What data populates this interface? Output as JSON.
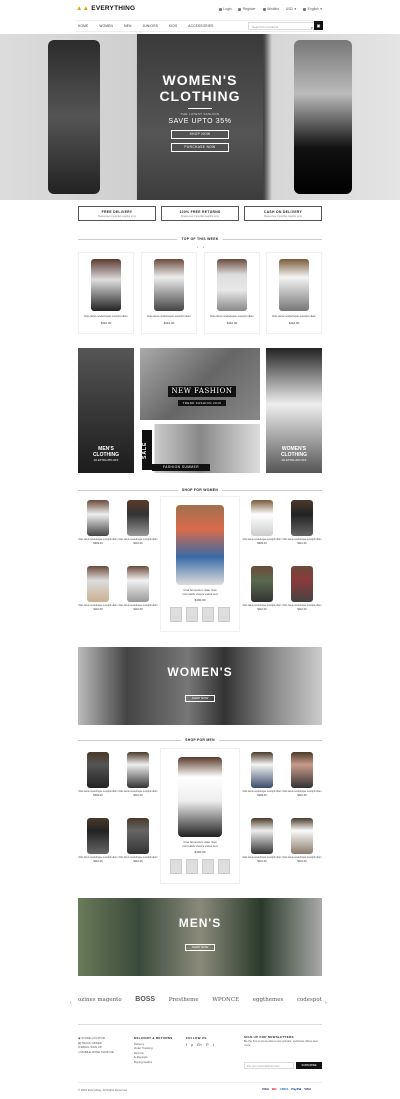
{
  "header": {
    "brand": "EVERYTHING",
    "links": [
      "Login",
      "Register",
      "Wishlist",
      "USD",
      "English"
    ],
    "nav": [
      "HOME",
      "WOMEN",
      "MEN",
      "JUNIORS",
      "KIDS",
      "ACCESSORIES"
    ],
    "search_placeholder": "Search for products"
  },
  "hero": {
    "title_line1": "WOMEN'S",
    "title_line2": "CLOTHING",
    "sub": "THE LATEST FASHION",
    "save": "SAVE UPTO 35%",
    "btn_shop": "SHOP NOW",
    "btn_purchase": "PURCHASE NOW"
  },
  "features": [
    {
      "title": "FREE DELIVERY",
      "text": "Maecenas imperdiet sagittis eros"
    },
    {
      "title": "100% FREE RETURNS",
      "text": "Maecenas imperdiet sagittis eros"
    },
    {
      "title": "CASH ON DELIVERY",
      "text": "Maecenas imperdiet sagittis eros"
    }
  ],
  "top_week": {
    "heading": "TOP OF THIS WEEK",
    "products": [
      {
        "name": "Duis lacus scelerisque suscipit ullam",
        "price": "$110.00"
      },
      {
        "name": "Duis lacus scelerisque suscipit ullam",
        "price": "$110.00"
      },
      {
        "name": "Duis lacus scelerisque suscipit ullam",
        "price": "$110.00"
      },
      {
        "name": "Duis lacus scelerisque suscipit ullam",
        "price": "$110.00"
      }
    ]
  },
  "banners": {
    "mens_line1": "MEN'S",
    "mens_line2": "CLOTHING",
    "mens_sub": "AN EXTRA 25% OFF",
    "new_fashion": "NEW FASHION",
    "trend": "TREND FASHION 2016",
    "sale": "SALE",
    "summer": "FASHION SUMMER",
    "womens_line1": "WOMEN'S",
    "womens_line2": "CLOTHING",
    "womens_sub": "AN EXTRA 20% OFF"
  },
  "shop_women": {
    "heading": "SHOP FOR WOMEN",
    "products": [
      {
        "name": "Duis lacus scelerisque suscipit ullam",
        "price": "$999.00"
      },
      {
        "name": "Duis lacus scelerisque suscipit ullam",
        "price": "$110.00"
      },
      {
        "name": "Duis lacus scelerisque suscipit ullam",
        "price": "$110.00"
      },
      {
        "name": "Duis lacus scelerisque suscipit ullam",
        "price": "$110.00"
      },
      {
        "name": "Duis lacus scelerisque suscipit ullam",
        "price": "$999.00"
      },
      {
        "name": "Duis lacus scelerisque suscipit ullam",
        "price": "$110.00"
      },
      {
        "name": "Duis lacus scelerisque suscipit ullam",
        "price": "$110.00"
      },
      {
        "name": "Duis lacus scelerisque suscipit ullam",
        "price": "$110.00"
      }
    ],
    "featured": {
      "name_line1": "Cras fermentum vitae risus",
      "name_line2": "nisl mattis viverra varius sed",
      "price": "$190.00"
    }
  },
  "womens_banner": {
    "title": "WOMEN'S",
    "button": "SHOP NOW"
  },
  "shop_men": {
    "heading": "SHOP FOR MEN",
    "products": [
      {
        "name": "Duis lacus scelerisque suscipit ullam",
        "price": "$999.00"
      },
      {
        "name": "Duis lacus scelerisque suscipit ullam",
        "price": "$110.00"
      },
      {
        "name": "Duis lacus scelerisque suscipit ullam",
        "price": "$110.00"
      },
      {
        "name": "Duis lacus scelerisque suscipit ullam",
        "price": "$110.00"
      },
      {
        "name": "Duis lacus scelerisque suscipit ullam",
        "price": "$999.00"
      },
      {
        "name": "Duis lacus scelerisque suscipit ullam",
        "price": "$110.00"
      },
      {
        "name": "Duis lacus scelerisque suscipit ullam",
        "price": "$110.00"
      },
      {
        "name": "Duis lacus scelerisque suscipit ullam",
        "price": "$110.00"
      }
    ],
    "featured": {
      "name_line1": "Cras fermentum vitae risus",
      "name_line2": "nisl mattis viverra varius sed",
      "price": "$190.00"
    }
  },
  "mens_banner": {
    "title": "MEN'S",
    "button": "SHOP NOW"
  },
  "brands": [
    "ozines magento",
    "BOSS",
    "Prestheme",
    "WPONCE",
    "eggthemes",
    "codespot"
  ],
  "footer": {
    "col1": [
      "STORE LOCATOR",
      "TRACK ORDER",
      "EMAIL SIGN UP",
      "MOBILE MORE SHOP ME"
    ],
    "col2_title": "DELIVERY & RETURNS",
    "col2": [
      "Delivery",
      "Order Tracking",
      "Returns",
      "E-Receipts",
      "Buying Guides"
    ],
    "col3_title": "FOLLOW US",
    "social": [
      "f",
      "y",
      "G+",
      "P",
      "t"
    ],
    "col4_title": "SIGN UP FOR NEWSLETTERS",
    "col4_text": "Be the first to know about new arrivals, exclusive offers and more",
    "newsletter_placeholder": "Put your email address here",
    "subscribe": "SUBSCRIBE",
    "copyright": "© 2015 Everything. All Rights Reserved.",
    "payments": [
      "VISA",
      "MC",
      "AMEX",
      "PayPal",
      "VISA"
    ]
  }
}
